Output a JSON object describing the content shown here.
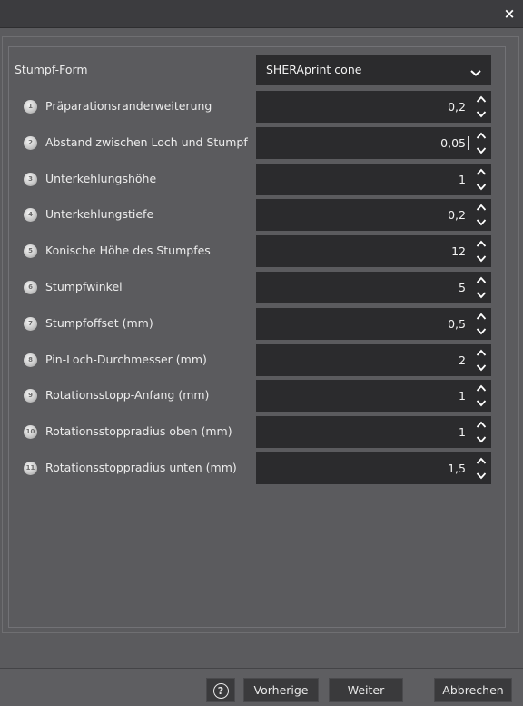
{
  "dialog": {
    "close_label": "×"
  },
  "form": {
    "shape": {
      "label": "Stumpf-Form",
      "value": "SHERAprint cone"
    },
    "params": [
      {
        "num": "1",
        "label": "Präparationsranderweiterung",
        "value": "0,2"
      },
      {
        "num": "2",
        "label": "Abstand zwischen Loch und Stumpf",
        "value": "0,05"
      },
      {
        "num": "3",
        "label": "Unterkehlungshöhe",
        "value": "1"
      },
      {
        "num": "4",
        "label": "Unterkehlungstiefe",
        "value": "0,2"
      },
      {
        "num": "5",
        "label": "Konische Höhe des Stumpfes",
        "value": "12"
      },
      {
        "num": "6",
        "label": "Stumpfwinkel",
        "value": "5"
      },
      {
        "num": "7",
        "label": "Stumpfoffset (mm)",
        "value": "0,5"
      },
      {
        "num": "8",
        "label": "Pin-Loch-Durchmesser (mm)",
        "value": "2"
      },
      {
        "num": "9",
        "label": "Rotationsstopp-Anfang (mm)",
        "value": "1"
      },
      {
        "num": "10",
        "label": "Rotationsstoppradius oben (mm)",
        "value": "1"
      },
      {
        "num": "11",
        "label": "Rotationsstoppradius unten (mm)",
        "value": "1,5"
      }
    ]
  },
  "footer": {
    "help_label": "?",
    "prev_label": "Vorherige",
    "next_label": "Weiter",
    "cancel_label": "Abbrechen"
  },
  "icons": {
    "spin": "up-down-chevron-icon",
    "dropdown": "chevron-down-icon",
    "step": "numbered-circle-icon"
  },
  "colors": {
    "background": "#5b5b5e",
    "field": "#2b2b2d",
    "titlebar": "#3c3c3f"
  }
}
